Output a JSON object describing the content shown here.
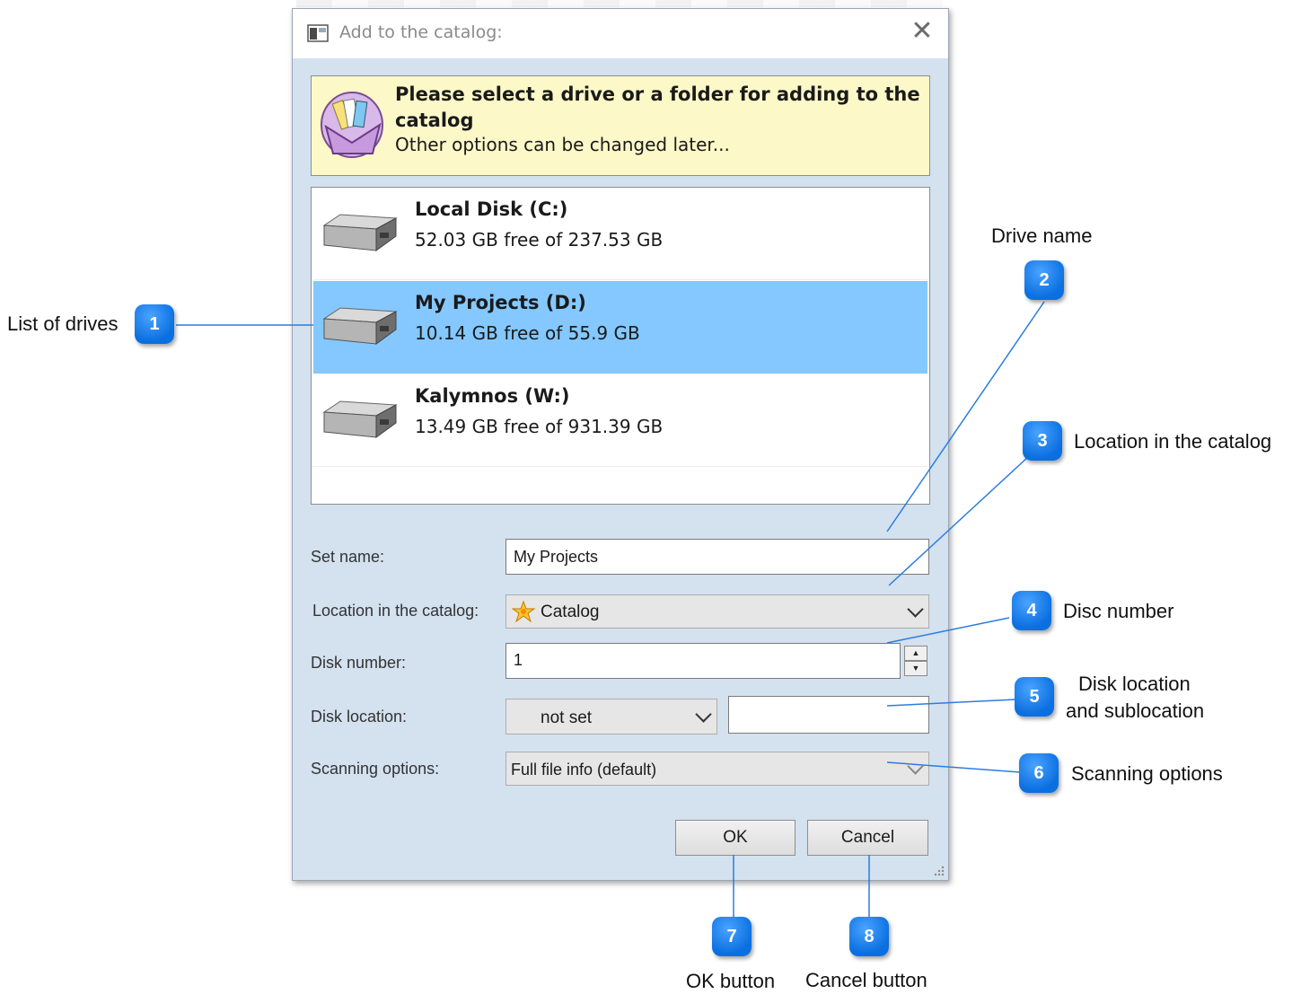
{
  "dialog": {
    "title": "Add to the catalog:",
    "close_glyph": "✕",
    "banner_title": "Please select a drive or a folder for adding to the catalog",
    "banner_subtitle": "Other options can be changed later...",
    "drives": [
      {
        "name": "Local Disk (C:)",
        "free": "52.03 GB free of 237.53 GB",
        "selected": false
      },
      {
        "name": "My Projects (D:)",
        "free": "10.14 GB free of 55.9 GB",
        "selected": true
      },
      {
        "name": "Kalymnos (W:)",
        "free": "13.49 GB free of 931.39 GB",
        "selected": false
      }
    ],
    "set_name_label": "Set name:",
    "set_name_value": "My Projects",
    "location_label": "Location in the catalog:",
    "location_value": "Catalog",
    "disk_number_label": "Disk number:",
    "disk_number_value": "1",
    "disk_location_label": "Disk location:",
    "disk_location_value": "not set",
    "disk_sublocation_value": "",
    "scanning_label": "Scanning options:",
    "scanning_value": "Full file info (default)",
    "ok_label": "OK",
    "cancel_label": "Cancel",
    "spin_up": "▲",
    "spin_down": "▼"
  },
  "annotations": {
    "accent": "#0a6fe0",
    "items": [
      {
        "number": "1",
        "label": "List of drives"
      },
      {
        "number": "2",
        "label": "Drive name"
      },
      {
        "number": "3",
        "label": "Location in the catalog"
      },
      {
        "number": "4",
        "label": "Disc number"
      },
      {
        "number": "5",
        "label_line1": "Disk location",
        "label_line2": "and sublocation"
      },
      {
        "number": "6",
        "label": "Scanning options"
      },
      {
        "number": "7",
        "label": "OK button"
      },
      {
        "number": "8",
        "label": "Cancel button"
      }
    ]
  }
}
